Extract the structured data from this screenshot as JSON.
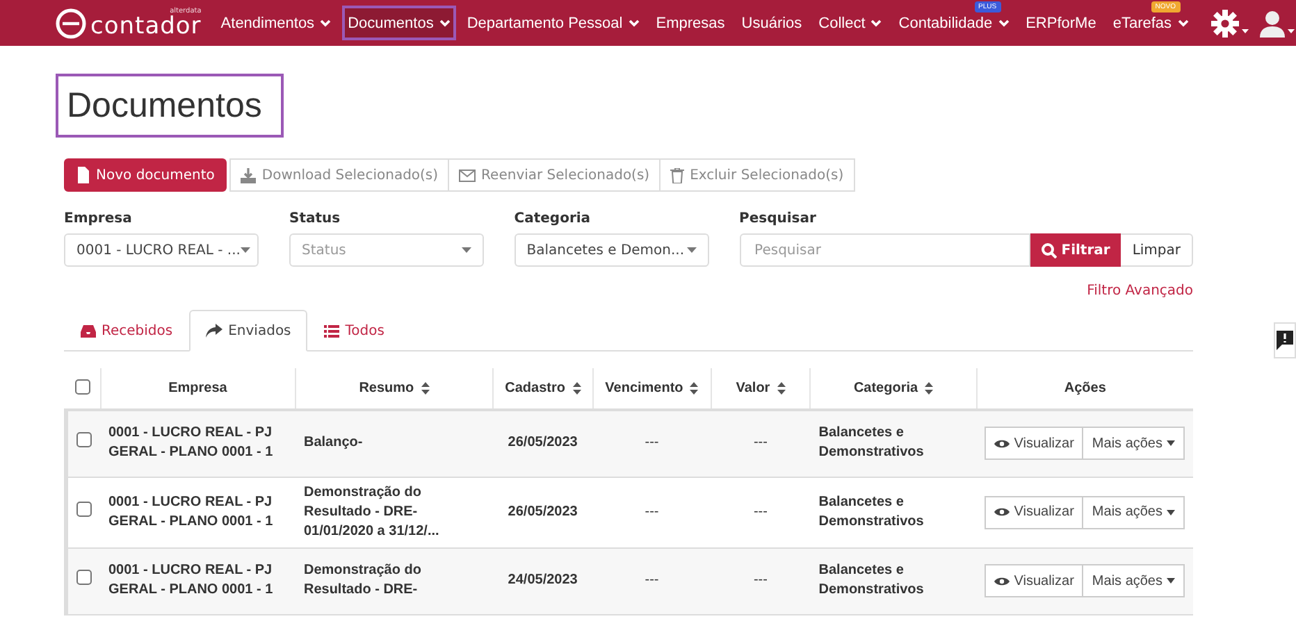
{
  "navbar": {
    "logo": "contador",
    "logo_tag": "alterdata",
    "items": [
      {
        "label": "Atendimentos",
        "dropdown": true,
        "selected": false
      },
      {
        "label": "Documentos",
        "dropdown": true,
        "selected": true
      },
      {
        "label": "Departamento Pessoal",
        "dropdown": true,
        "selected": false
      },
      {
        "label": "Empresas",
        "dropdown": false,
        "selected": false
      },
      {
        "label": "Usuários",
        "dropdown": false,
        "selected": false
      },
      {
        "label": "Collect",
        "dropdown": true,
        "selected": false
      },
      {
        "label": "Contabilidade",
        "dropdown": true,
        "selected": false,
        "badge": "PLUS"
      },
      {
        "label": "ERPforMe",
        "dropdown": false,
        "selected": false
      },
      {
        "label": "eTarefas",
        "dropdown": true,
        "selected": false,
        "badge": "NOVO"
      }
    ]
  },
  "page": {
    "title": "Documentos",
    "title_highlighted": true
  },
  "toolbar": [
    {
      "label": "Novo documento",
      "kind": "primary"
    },
    {
      "label": "Download Selecionado(s)",
      "kind": "default"
    },
    {
      "label": "Reenviar Selecionado(s)",
      "kind": "default"
    },
    {
      "label": "Excluir Selecionado(s)",
      "kind": "default"
    }
  ],
  "filters": [
    {
      "label": "Empresa",
      "value": "0001 - LUCRO REAL - ..."
    },
    {
      "label": "Status",
      "placeholder": "Status"
    },
    {
      "label": "Categoria",
      "value": "Balancetes e Demon..."
    }
  ],
  "search": {
    "label": "Pesquisar",
    "placeholder": "Pesquisar",
    "filter_button": "Filtrar",
    "clear_button": "Limpar",
    "advanced_link": "Filtro Avançado"
  },
  "tabs": [
    {
      "label": "Recebidos",
      "selected": false
    },
    {
      "label": "Enviados",
      "selected": true
    },
    {
      "label": "Todos",
      "selected": false
    }
  ],
  "table": {
    "select_all_checked": false,
    "columns": [
      {
        "label": "Empresa"
      },
      {
        "label": "Resumo",
        "sortable": true
      },
      {
        "label": "Cadastro",
        "sortable": true
      },
      {
        "label": "Vencimento",
        "sortable": true
      },
      {
        "label": "Valor",
        "sortable": true
      },
      {
        "label": "Categoria",
        "sortable": true
      },
      {
        "label": "Ações"
      }
    ],
    "rows": [
      {
        "checked": false,
        "empresa": "0001 - LUCRO REAL - PJ GERAL - PLANO 0001 - 1",
        "resumo": "Balanço-",
        "cadastro": "26/05/2023",
        "vencimento": "---",
        "valor": "---",
        "categoria": "Balancetes e Demonstrativos",
        "view_button": "Visualizar",
        "more_button": "Mais ações"
      },
      {
        "checked": false,
        "empresa": "0001 - LUCRO REAL - PJ GERAL - PLANO 0001 - 1",
        "resumo": "Demonstração do Resultado - DRE-01/01/2020 a 31/12/...",
        "cadastro": "26/05/2023",
        "vencimento": "---",
        "valor": "---",
        "categoria": "Balancetes e Demonstrativos",
        "view_button": "Visualizar",
        "more_button": "Mais ações"
      },
      {
        "checked": false,
        "empresa": "0001 - LUCRO REAL - PJ GERAL - PLANO 0001 - 1",
        "resumo": "Demonstração do Resultado - DRE-",
        "cadastro": "24/05/2023",
        "vencimento": "---",
        "valor": "---",
        "categoria": "Balancetes e Demonstrativos",
        "view_button": "Visualizar",
        "more_button": "Mais ações"
      }
    ]
  }
}
